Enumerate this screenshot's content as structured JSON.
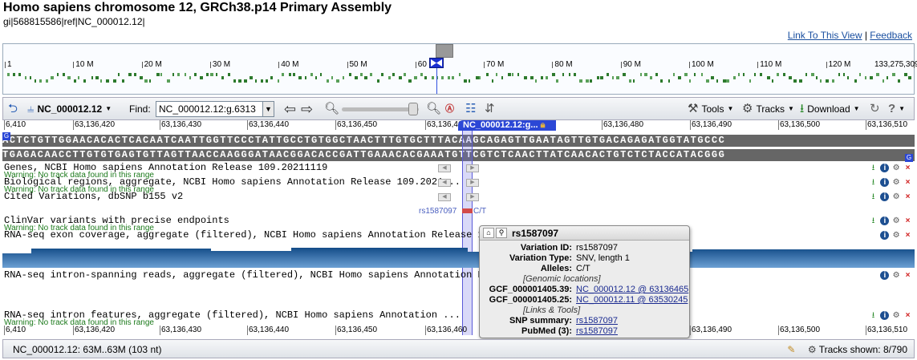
{
  "header": {
    "title": "Homo sapiens chromosome 12, GRCh38.p14 Primary Assembly",
    "gi": "gi|568815586|ref|NC_000012.12|",
    "link_view": "Link To This View",
    "link_sep": "|",
    "link_feedback": "Feedback"
  },
  "overview": {
    "ticks": [
      "1",
      "10 M",
      "20 M",
      "30 M",
      "40 M",
      "50 M",
      "60 M",
      "70 M",
      "80 M",
      "90 M",
      "100 M",
      "110 M",
      "120 M",
      "133,275,309"
    ],
    "current_position_mb": 63.1
  },
  "toolbar": {
    "sequence_id": "NC_000012.12",
    "find_label": "Find:",
    "find_value": "NC_000012.12:g.6313",
    "tools": "Tools",
    "tracks": "Tracks",
    "download": "Download",
    "help": "?",
    "zoom_level": 0.92
  },
  "ruler": {
    "ticks": [
      "6,410",
      "63,136,420",
      "63,136,430",
      "63,136,440",
      "63,136,450",
      "63,136,46",
      "63,136,480",
      "63,136,490",
      "63,136,500",
      "63,136,510"
    ],
    "bottom_ticks": [
      "6,410",
      "63,136,420",
      "63,136,430",
      "63,136,440",
      "63,136,450",
      "63,136,460",
      "63,136,490",
      "63,136,500",
      "63,136,510"
    ]
  },
  "sequence": {
    "forward": "ACTCTGTTGGAACACACTCACAATCAATTGGTTCCCTATTGCCTGTGGCTAACTTTGTGCTTTACAAGCAGAGTTGAATAGTTGTGACAGAGATGGTATGCCC",
    "reverse": "TGAGACAACCTTGTGTGAGTGTTAGTTAACCAAGGGATAACGGACACCGATTGAAACACGAAATGTTCGTCTCAACTTATCAACACTGTCTCTACCATACGGG",
    "marker_left": "G",
    "marker_right": "G",
    "selection_flag": "NC_000012.12:g..."
  },
  "tracks": [
    {
      "label": "Genes, NCBI Homo sapiens Annotation Release 109.20211119",
      "warning": "Warning: No track data found in this range"
    },
    {
      "label": "Biological regions, aggregate, NCBI Homo sapiens Annotation Release 109.2021...",
      "warning": "Warning: No track data found in this range"
    },
    {
      "label": "Cited Variations, dbSNP b155 v2",
      "warning": ""
    },
    {
      "label": "ClinVar variants with precise endpoints",
      "warning": "Warning: No track data found in this range"
    },
    {
      "label": "RNA-seq exon coverage, aggregate (filtered), NCBI Homo sapiens Annotation Release 109",
      "warning": ""
    },
    {
      "label": "RNA-seq intron-spanning reads, aggregate (filtered), NCBI Homo sapiens Annotation Rel",
      "warning": ""
    },
    {
      "label": "RNA-seq intron features, aggregate (filtered), NCBI Homo sapiens Annotation ...",
      "warning": "Warning: No track data found in this range"
    }
  ],
  "snp_feature": {
    "label": "rs1587097",
    "alleles": "C/T"
  },
  "tooltip": {
    "title": "rs1587097",
    "rows": [
      {
        "key": "Variation ID:",
        "value": "rs1587097"
      },
      {
        "key": "Variation Type:",
        "value": "SNV, length 1"
      },
      {
        "key": "Alleles:",
        "value": "C/T"
      }
    ],
    "section_genomic": "[Genomic locations]",
    "genomic": [
      {
        "key": "GCF_000001405.39:",
        "value": "NC_000012.12 @ 63136465"
      },
      {
        "key": "GCF_000001405.25:",
        "value": "NC_000012.11 @ 63530245"
      }
    ],
    "section_links": "[Links & Tools]",
    "links": [
      {
        "key": "SNP summary:",
        "value": "rs1587097"
      },
      {
        "key": "PubMed (3):",
        "value": "rs1587097"
      }
    ]
  },
  "status": {
    "range": "NC_000012.12: 63M..63M (103 nt)",
    "tracks_shown": "Tracks shown: 8/790"
  },
  "colors": {
    "selection": "#2b47d6",
    "sequence_bg": "#666666",
    "coverage": "#1e5a9a",
    "warning": "#1c7a1c",
    "link": "#1a4fa0"
  }
}
